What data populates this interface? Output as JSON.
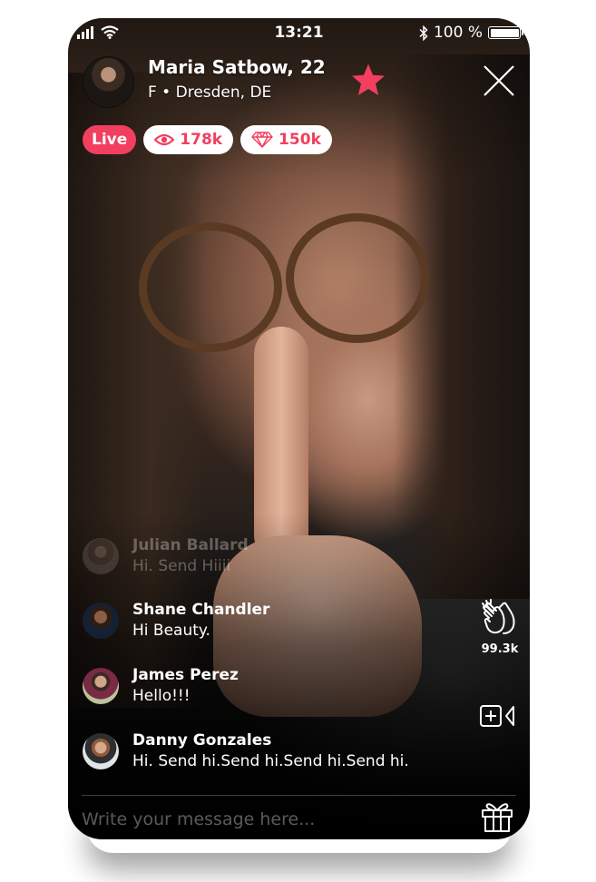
{
  "status_bar": {
    "time": "13:21",
    "battery_text": "100 %",
    "battery_level_percent": 100,
    "icons": [
      "signal-icon",
      "wifi-icon",
      "bluetooth-icon",
      "battery-icon"
    ]
  },
  "profile": {
    "name": "Maria Satbow, 22",
    "meta": "F • Dresden, DE",
    "favorite_icon": "star-icon",
    "close_icon": "close-icon"
  },
  "badges": {
    "live_label": "Live",
    "viewers": "178k",
    "viewers_icon": "eye-icon",
    "gems": "150k",
    "gems_icon": "diamond-icon"
  },
  "comments": [
    {
      "name": "Julian Ballard",
      "message": "Hi. Send Hiiii",
      "faded": true
    },
    {
      "name": "Shane Chandler",
      "message": "Hi Beauty."
    },
    {
      "name": "James Perez",
      "message": "Hello!!!"
    },
    {
      "name": "Danny Gonzales",
      "message": "Hi. Send hi.Send hi.Send hi.Send hi."
    }
  ],
  "actions": {
    "clap_count": "99.3k",
    "clap_icon": "clap-icon",
    "video_icon": "add-video-icon"
  },
  "composer": {
    "placeholder": "Write your message here...",
    "value": "",
    "gift_icon": "gift-icon"
  },
  "colors": {
    "accent": "#f23f5f",
    "text": "#ffffff"
  }
}
